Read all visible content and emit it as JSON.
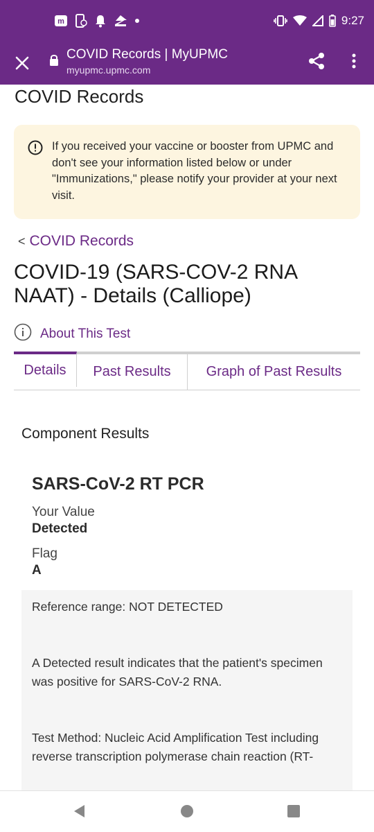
{
  "status_bar": {
    "time": "9:27",
    "left_icons": [
      "myupmc-app-icon",
      "phone-sync-icon",
      "bell-icon",
      "zillow-icon",
      "dot-icon"
    ],
    "right_icons": [
      "vibrate-icon",
      "wifi-icon",
      "signal-icon",
      "battery-icon"
    ]
  },
  "browser": {
    "title": "COVID Records | MyUPMC",
    "url": "myupmc.upmc.com"
  },
  "page": {
    "title": "COVID Records",
    "notice": "If you received your vaccine or booster from UPMC and don't see your information listed below or under \"Immunizations,\" please notify your provider at your next visit.",
    "back_link": "COVID Records",
    "back_chevron": "<",
    "test_title": "COVID-19 (SARS-COV-2 RNA NAAT) - Details (Calliope)",
    "about_label": "About This Test"
  },
  "tabs": [
    {
      "label": "Details",
      "active": true
    },
    {
      "label": "Past Results",
      "active": false
    },
    {
      "label": "Graph of Past Results",
      "active": false
    }
  ],
  "component": {
    "heading": "Component Results",
    "name": "SARS-CoV-2 RT PCR",
    "your_value_label": "Your Value",
    "your_value": "Detected",
    "flag_label": "Flag",
    "flag": "A",
    "reference": {
      "line1": "Reference range: NOT DETECTED",
      "para1": "A Detected result indicates that the patient's specimen\nwas positive for SARS-CoV-2 RNA.",
      "para2": "Test Method: Nucleic Acid Amplification Test including\nreverse transcription polymerase chain reaction (RT-"
    }
  },
  "colors": {
    "brand_purple": "#6b2a86",
    "notice_bg": "#fdf5e0",
    "ref_bg": "#f5f5f5"
  }
}
